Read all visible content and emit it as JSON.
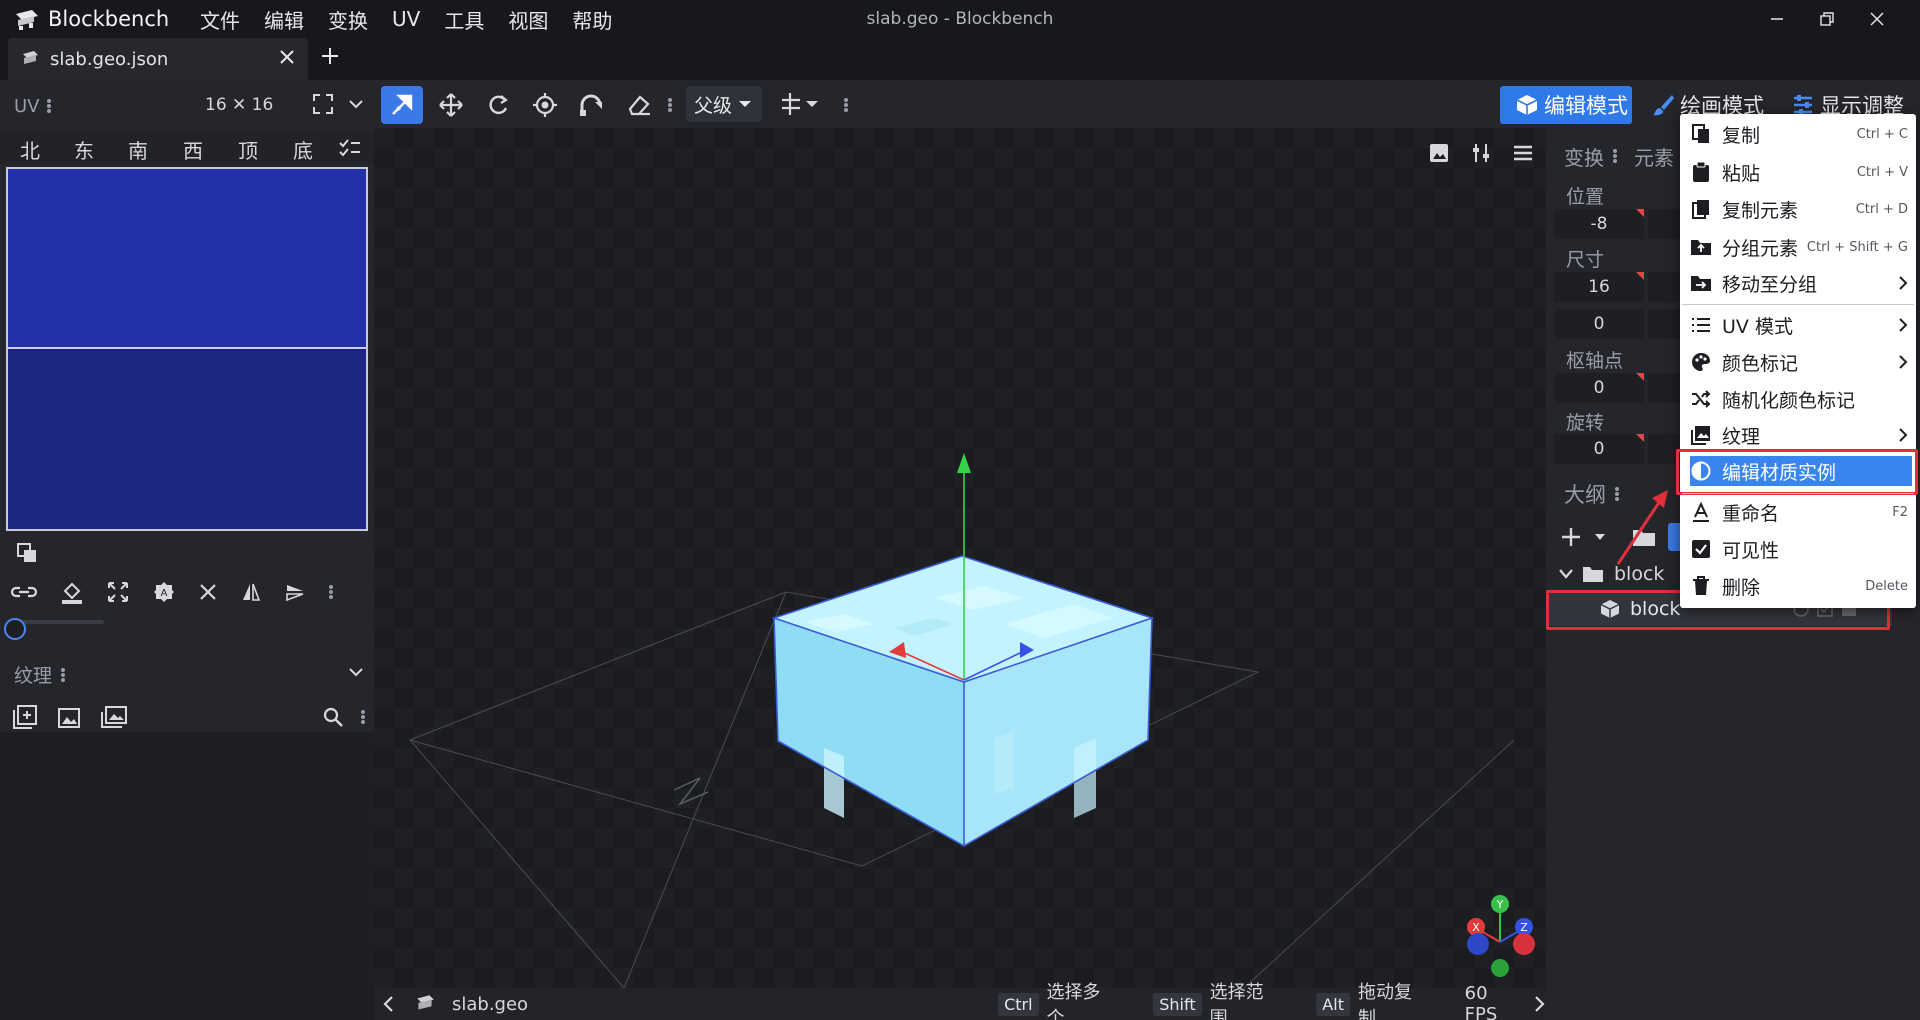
{
  "app": {
    "name": "Blockbench",
    "window_title": "slab.geo - Blockbench"
  },
  "menus": [
    "文件",
    "编辑",
    "变换",
    "UV",
    "工具",
    "视图",
    "帮助"
  ],
  "tab": {
    "label": "slab.geo.json"
  },
  "uv_panel": {
    "title": "UV",
    "size": "16 ✕ 16",
    "faces": [
      "北",
      "东",
      "南",
      "西",
      "顶",
      "底"
    ],
    "textures_title": "纹理"
  },
  "toolbar": {
    "parent_label": "父级",
    "modes": {
      "edit": "编辑模式",
      "paint": "绘画模式",
      "display": "显示调整"
    }
  },
  "properties": {
    "tab_transform": "变换",
    "tab_element": "元素",
    "position_label": "位置",
    "position_x": "-8",
    "size_label": "尺寸",
    "size_x": "16",
    "inflate_value": "0",
    "pivot_label": "枢轴点",
    "pivot_x": "0",
    "rotation_label": "旋转",
    "rotation_x": "0"
  },
  "outliner": {
    "title": "大纲",
    "group": "block",
    "cube": "block"
  },
  "context_menu": [
    {
      "label": "复制",
      "shortcut": "Ctrl + C",
      "icon": "copy-icon"
    },
    {
      "label": "粘贴",
      "shortcut": "Ctrl + V",
      "icon": "paste-icon"
    },
    {
      "label": "复制元素",
      "shortcut": "Ctrl + D",
      "icon": "duplicate-icon"
    },
    {
      "label": "分组元素",
      "shortcut": "Ctrl + Shift + G",
      "icon": "group-icon"
    },
    {
      "label": "移动至分组",
      "icon": "move-to-group-icon",
      "submenu": true
    },
    {
      "label": "UV 模式",
      "icon": "uv-mode-icon",
      "submenu": true
    },
    {
      "label": "颜色标记",
      "icon": "palette-icon",
      "submenu": true
    },
    {
      "label": "随机化颜色标记",
      "icon": "shuffle-icon"
    },
    {
      "label": "纹理",
      "icon": "image-icon",
      "submenu": true
    },
    {
      "label": "编辑材质实例",
      "icon": "material-icon",
      "highlighted": true
    },
    {
      "label": "重命名",
      "shortcut": "F2",
      "icon": "rename-icon"
    },
    {
      "label": "可见性",
      "icon": "checkbox-icon"
    },
    {
      "label": "删除",
      "shortcut": "Delete",
      "icon": "trash-icon"
    }
  ],
  "statusbar": {
    "model_name": "slab.geo",
    "ctrl_key": "Ctrl",
    "ctrl_hint": "选择多个",
    "shift_key": "Shift",
    "shift_hint": "选择范围",
    "alt_key": "Alt",
    "alt_hint": "拖动复制",
    "fps": "60 FPS"
  },
  "gizmo_axes": {
    "y": "Y",
    "x": "X",
    "z": "Z"
  },
  "colors": {
    "accent": "#3b79e6",
    "highlight_box": "#e0303a",
    "menu_selected": "#3a84ee"
  }
}
